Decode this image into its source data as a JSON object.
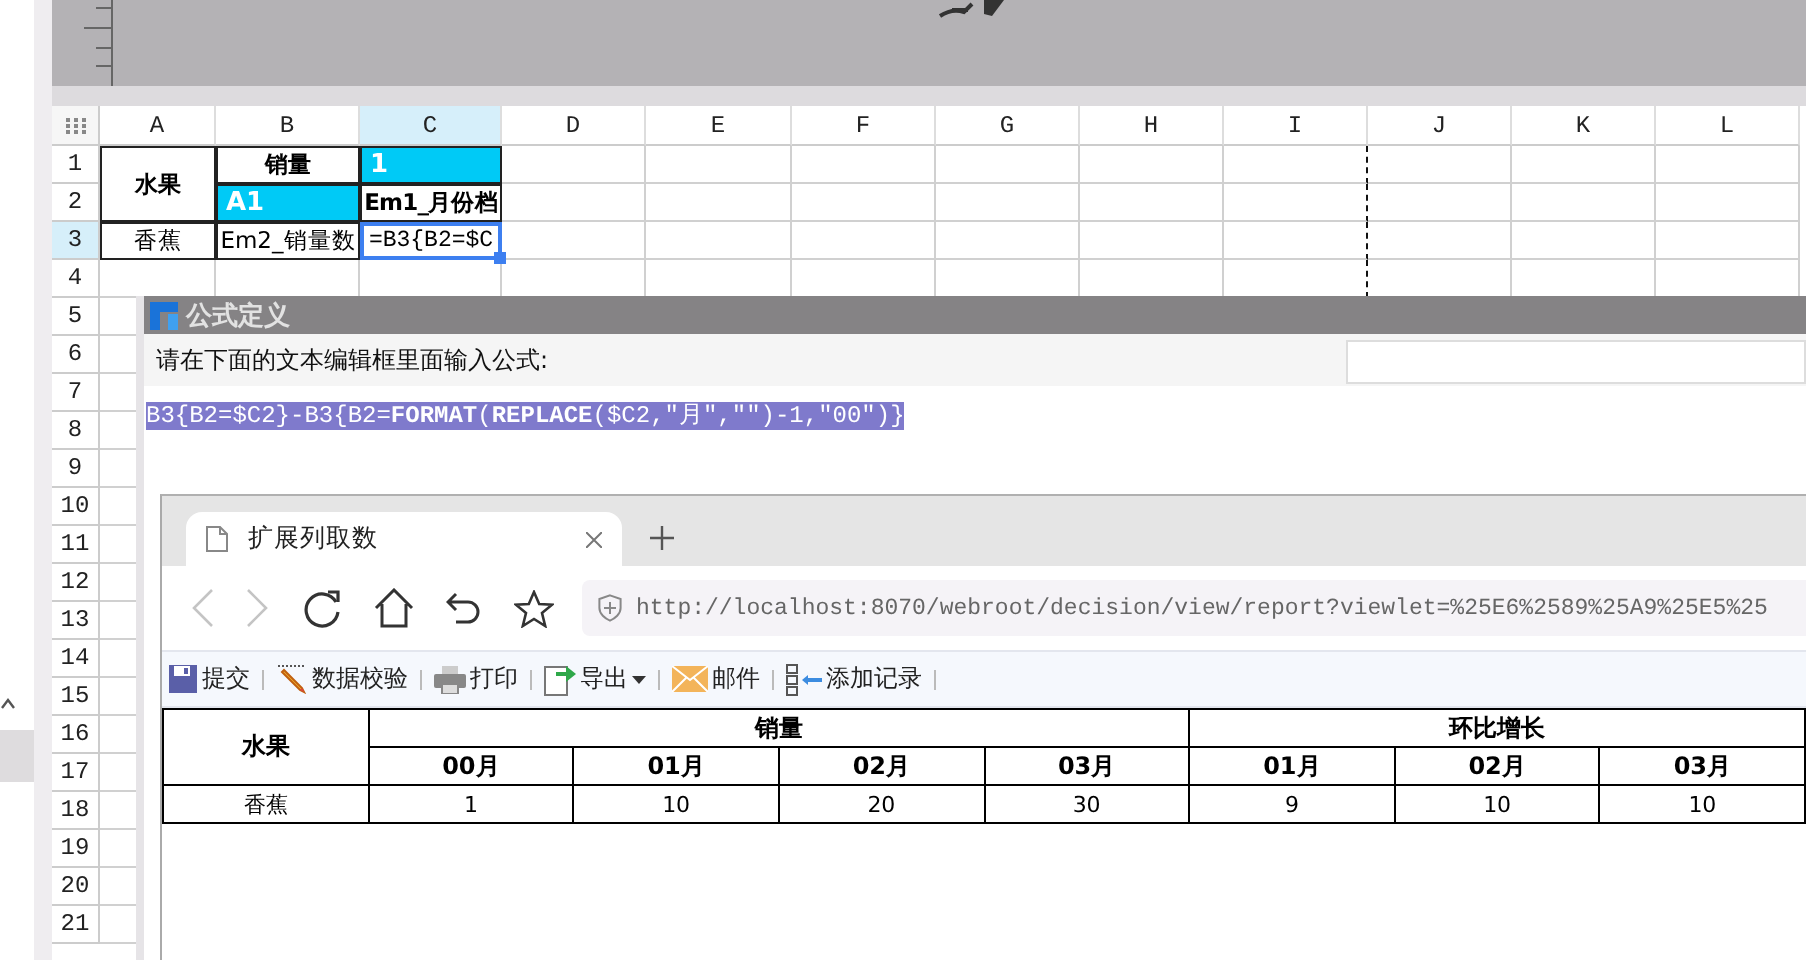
{
  "spreadsheet": {
    "columns": [
      {
        "label": "A",
        "selected": false
      },
      {
        "label": "B",
        "selected": false
      },
      {
        "label": "C",
        "selected": true
      },
      {
        "label": "D",
        "selected": false
      },
      {
        "label": "E",
        "selected": false
      },
      {
        "label": "F",
        "selected": false
      },
      {
        "label": "G",
        "selected": false
      },
      {
        "label": "H",
        "selected": false
      },
      {
        "label": "I",
        "selected": false
      },
      {
        "label": "J",
        "selected": false
      },
      {
        "label": "K",
        "selected": false
      },
      {
        "label": "L",
        "selected": false
      }
    ],
    "rows": [
      {
        "label": "1",
        "selected": false,
        "cells": [
          {
            "kind": "merged-top",
            "text": "水果",
            "bold": true,
            "selected": false
          },
          {
            "kind": "text",
            "text": "销量",
            "bold": true,
            "selected": false
          },
          {
            "kind": "tag",
            "tag": "1"
          }
        ]
      },
      {
        "label": "2",
        "selected": false,
        "cells": [
          {
            "kind": "merged-rest"
          },
          {
            "kind": "tag",
            "tag": "A1"
          },
          {
            "kind": "text",
            "text": "Em1_月份档",
            "bold": true,
            "selected": false
          }
        ]
      },
      {
        "label": "3",
        "selected": true,
        "cells": [
          {
            "kind": "text",
            "text": "香蕉",
            "bold": false,
            "selected": false
          },
          {
            "kind": "text",
            "text": "Em2_销量数",
            "bold": false,
            "selected": false
          },
          {
            "kind": "text",
            "text": "=B3{B2=$C",
            "bold": false,
            "selected": true
          }
        ]
      },
      {
        "label": "4",
        "selected": false
      },
      {
        "label": "5",
        "selected": false
      },
      {
        "label": "6",
        "selected": false
      },
      {
        "label": "7",
        "selected": false
      },
      {
        "label": "8",
        "selected": false
      },
      {
        "label": "9",
        "selected": false
      },
      {
        "label": "10",
        "selected": false
      },
      {
        "label": "11",
        "selected": false
      },
      {
        "label": "12",
        "selected": false
      },
      {
        "label": "13",
        "selected": false
      },
      {
        "label": "14",
        "selected": false
      },
      {
        "label": "15",
        "selected": false
      },
      {
        "label": "16",
        "selected": false
      },
      {
        "label": "17",
        "selected": false
      },
      {
        "label": "18",
        "selected": false
      },
      {
        "label": "19",
        "selected": false
      },
      {
        "label": "20",
        "selected": false
      },
      {
        "label": "21",
        "selected": false
      }
    ]
  },
  "dialog": {
    "title": "公式定义",
    "prompt": "请在下面的文本编辑框里面输入公式:",
    "formula": "B3{B2=$C2}-B3{B2=**FORMAT**(**REPLACE**($C2,\"月\",\"\")-1,\"00\")}"
  },
  "browser": {
    "tabs": [
      {
        "title": "扩展列取数",
        "selected": true
      }
    ],
    "nav_buttons": [
      {
        "kind": "back",
        "disabled": true
      },
      {
        "kind": "forward",
        "disabled": true
      },
      {
        "kind": "reload",
        "disabled": false
      },
      {
        "kind": "home",
        "disabled": false
      },
      {
        "kind": "undo",
        "disabled": false
      },
      {
        "kind": "star",
        "disabled": false
      }
    ],
    "url": "http://localhost:8070/webroot/decision/view/report?viewlet=%25E6%2589%25A9%25E5%25",
    "toolbar": [
      {
        "kind": "submit",
        "label": "提交",
        "dropdown": false
      },
      {
        "kind": "validate",
        "label": "数据校验",
        "dropdown": false
      },
      {
        "kind": "print",
        "label": "打印",
        "dropdown": false
      },
      {
        "kind": "export",
        "label": "导出",
        "dropdown": true
      },
      {
        "kind": "mail",
        "label": "邮件",
        "dropdown": false
      },
      {
        "kind": "add",
        "label": "添加记录",
        "dropdown": false
      }
    ],
    "report": {
      "row_header": "水果",
      "groups": [
        {
          "title": "销量",
          "months": [
            "00月",
            "01月",
            "02月",
            "03月"
          ]
        },
        {
          "title": "环比增长",
          "months": [
            "01月",
            "02月",
            "03月"
          ]
        }
      ],
      "rows": [
        {
          "name": "香蕉",
          "values": [
            "1",
            "10",
            "20",
            "30",
            "9",
            "10",
            "10"
          ]
        }
      ]
    }
  }
}
